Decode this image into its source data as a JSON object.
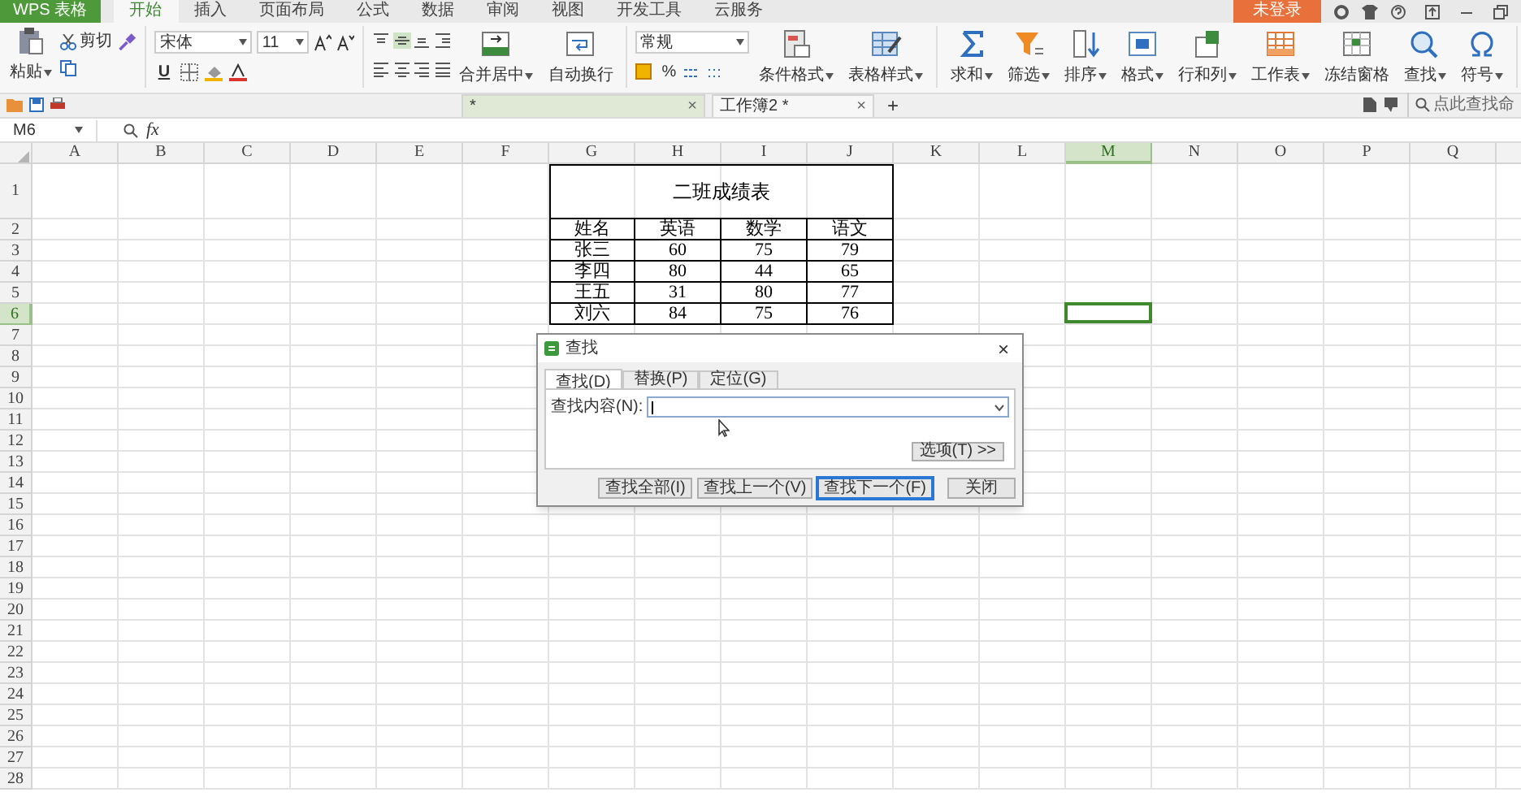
{
  "menu_bar": {
    "app_button": "WPS 表格",
    "tabs": [
      {
        "label": "开始",
        "selected": true
      },
      {
        "label": "插入",
        "selected": false
      },
      {
        "label": "页面布局",
        "selected": false
      },
      {
        "label": "公式",
        "selected": false
      },
      {
        "label": "数据",
        "selected": false
      },
      {
        "label": "审阅",
        "selected": false
      },
      {
        "label": "视图",
        "selected": false
      },
      {
        "label": "开发工具",
        "selected": false
      },
      {
        "label": "云服务",
        "selected": false
      }
    ],
    "login_button": "未登录"
  },
  "ribbon": {
    "paste": "粘贴",
    "cut": "剪切",
    "font_name": "宋体",
    "font_size": "11",
    "underline": "U",
    "number_format": "常规",
    "percent": "%",
    "align_commands": [
      {
        "label": "合并居中",
        "kind": "merge",
        "dropdown": true
      },
      {
        "label": "自动换行",
        "kind": "wrap",
        "dropdown": false
      }
    ],
    "style_commands": [
      {
        "label": "条件格式",
        "kind": "conditional",
        "dropdown": true
      },
      {
        "label": "表格样式",
        "kind": "tablestyle",
        "dropdown": true
      }
    ],
    "edit_commands": [
      {
        "label": "求和",
        "kind": "sum",
        "dropdown": true
      },
      {
        "label": "筛选",
        "kind": "filter",
        "dropdown": true
      },
      {
        "label": "排序",
        "kind": "sort",
        "dropdown": true
      },
      {
        "label": "格式",
        "kind": "format",
        "dropdown": true
      },
      {
        "label": "行和列",
        "kind": "rowcol",
        "dropdown": true
      },
      {
        "label": "工作表",
        "kind": "sheet",
        "dropdown": true
      },
      {
        "label": "冻结窗格",
        "kind": "freeze",
        "dropdown": false
      },
      {
        "label": "查找",
        "kind": "find",
        "dropdown": true
      },
      {
        "label": "符号",
        "kind": "symbol",
        "dropdown": true
      }
    ]
  },
  "doc_tabs": {
    "tabs": [
      {
        "label": "*",
        "selected": true,
        "close": "×"
      },
      {
        "label": "工作簿2 *",
        "selected": false,
        "close": "×"
      }
    ],
    "new_tab": "+",
    "search": {
      "placeholder": "点此查找命"
    }
  },
  "formula_bar": {
    "name_box": "M6",
    "fx": "fx"
  },
  "sheet": {
    "columns": [
      {
        "label": "A",
        "selected": false
      },
      {
        "label": "B",
        "selected": false
      },
      {
        "label": "C",
        "selected": false
      },
      {
        "label": "D",
        "selected": false
      },
      {
        "label": "E",
        "selected": false
      },
      {
        "label": "F",
        "selected": false
      },
      {
        "label": "G",
        "selected": false
      },
      {
        "label": "H",
        "selected": false
      },
      {
        "label": "I",
        "selected": false
      },
      {
        "label": "J",
        "selected": false
      },
      {
        "label": "K",
        "selected": false
      },
      {
        "label": "L",
        "selected": false
      },
      {
        "label": "M",
        "selected": true
      },
      {
        "label": "N",
        "selected": false
      },
      {
        "label": "O",
        "selected": false
      },
      {
        "label": "P",
        "selected": false
      },
      {
        "label": "Q",
        "selected": false
      }
    ],
    "rows": [
      {
        "label": "1",
        "selected": false
      },
      {
        "label": "2",
        "selected": false
      },
      {
        "label": "3",
        "selected": false
      },
      {
        "label": "4",
        "selected": false
      },
      {
        "label": "5",
        "selected": false
      },
      {
        "label": "6",
        "selected": true
      },
      {
        "label": "7",
        "selected": false
      },
      {
        "label": "8",
        "selected": false
      },
      {
        "label": "9",
        "selected": false
      },
      {
        "label": "10",
        "selected": false
      },
      {
        "label": "11",
        "selected": false
      },
      {
        "label": "12",
        "selected": false
      },
      {
        "label": "13",
        "selected": false
      },
      {
        "label": "14",
        "selected": false
      },
      {
        "label": "15",
        "selected": false
      },
      {
        "label": "16",
        "selected": false
      },
      {
        "label": "17",
        "selected": false
      },
      {
        "label": "18",
        "selected": false
      },
      {
        "label": "19",
        "selected": false
      },
      {
        "label": "20",
        "selected": false
      },
      {
        "label": "21",
        "selected": false
      },
      {
        "label": "22",
        "selected": false
      },
      {
        "label": "23",
        "selected": false
      },
      {
        "label": "24",
        "selected": false
      },
      {
        "label": "25",
        "selected": false
      },
      {
        "label": "26",
        "selected": false
      },
      {
        "label": "27",
        "selected": false
      },
      {
        "label": "28",
        "selected": false
      }
    ],
    "table": {
      "title": "二班成绩表",
      "header": [
        "姓名",
        "英语",
        "数学",
        "语文"
      ],
      "records": [
        [
          "张三",
          "60",
          "75",
          "79"
        ],
        [
          "李四",
          "80",
          "44",
          "65"
        ],
        [
          "王五",
          "31",
          "80",
          "77"
        ],
        [
          "刘六",
          "84",
          "75",
          "76"
        ]
      ]
    }
  },
  "dialog": {
    "title": "查找",
    "close": "×",
    "tabs": [
      {
        "label": "查找(D)",
        "selected": true
      },
      {
        "label": "替换(P)",
        "selected": false
      },
      {
        "label": "定位(G)",
        "selected": false
      }
    ],
    "field_label": "查找内容(N):",
    "options_button": "选项(T) >>",
    "buttons": [
      {
        "label": "查找全部(I)",
        "default": false
      },
      {
        "label": "查找上一个(V)",
        "default": false
      },
      {
        "label": "查找下一个(F)",
        "default": true
      },
      {
        "label": "关闭",
        "default": false
      }
    ]
  }
}
